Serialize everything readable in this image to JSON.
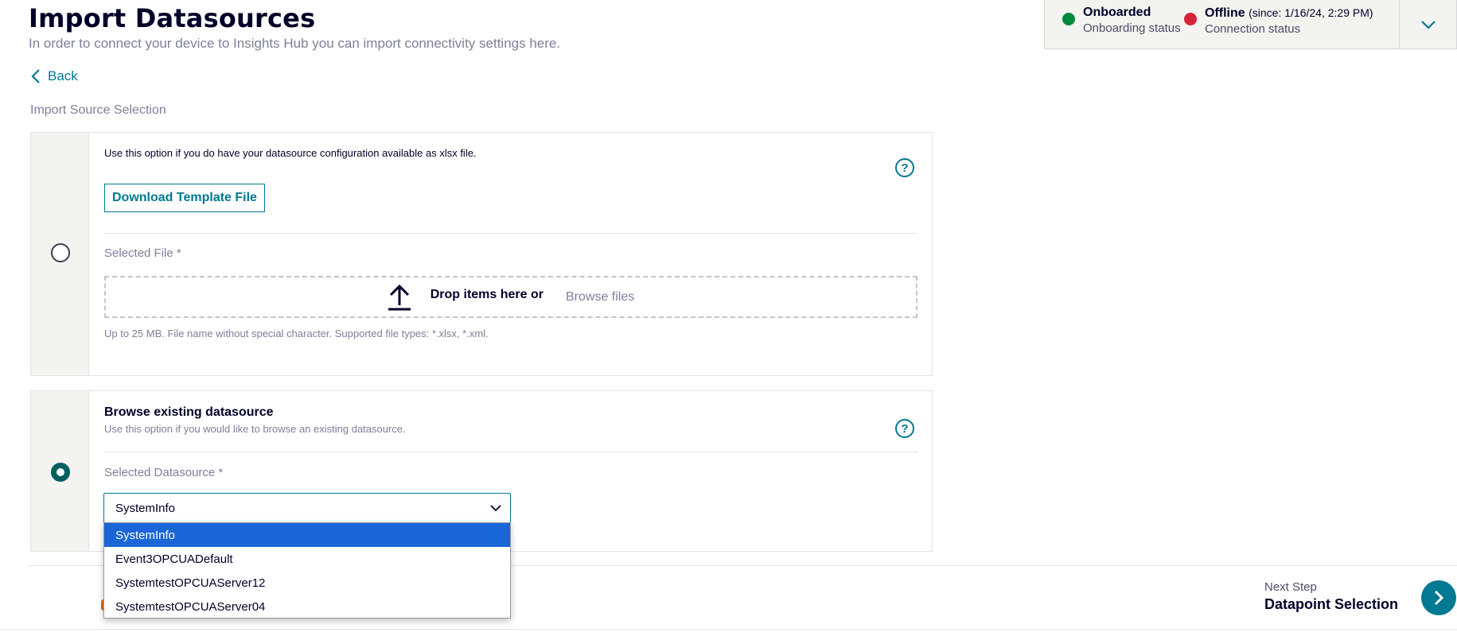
{
  "header": {
    "title": "Import Datasources",
    "subtitle": "In order to connect your device to Insights Hub you can import connectivity settings here.",
    "back_label": "Back",
    "section_label": "Import Source Selection"
  },
  "status": {
    "onboarding": {
      "value": "Onboarded",
      "label": "Onboarding status",
      "color": "#01893a"
    },
    "connection": {
      "value": "Offline",
      "since": "(since: 1/16/24, 2:29 PM)",
      "label": "Connection status",
      "color": "#d72339"
    }
  },
  "file_option": {
    "description": "Use this option if you do have your datasource configuration available as xlsx file.",
    "download_button": "Download Template File",
    "field_label": "Selected File *",
    "drop_text": "Drop items here or",
    "browse_text": "Browse files",
    "hint": "Up to 25 MB. File name without special character. Supported file types: *.xlsx, *.xml.",
    "help": "?"
  },
  "browse_option": {
    "title": "Browse existing datasource",
    "description": "Use this option if you would like to browse an existing datasource.",
    "field_label": "Selected Datasource *",
    "selected_value": "SystemInfo",
    "options": [
      "SystemInfo",
      "Event3OPCUADefault",
      "SystemtestOPCUAServer12",
      "SystemtestOPCUAServer04"
    ],
    "help": "?"
  },
  "footer": {
    "next_small": "Next Step",
    "next_big": "Datapoint Selection"
  },
  "colors": {
    "accent": "#007993",
    "selected_option": "#1a66d6",
    "radio_checked": "#005f5f"
  }
}
